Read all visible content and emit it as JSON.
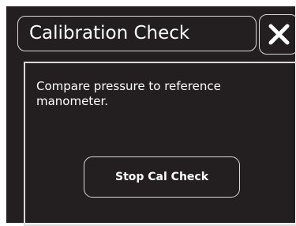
{
  "dialog": {
    "title": "Calibration Check",
    "message": "Compare pressure to reference manometer.",
    "stop_button_label": "Stop Cal Check"
  },
  "icons": {
    "close": "close-icon"
  },
  "colors": {
    "background": "#231f20",
    "border": "#d8d8d8",
    "text": "#ffffff"
  }
}
